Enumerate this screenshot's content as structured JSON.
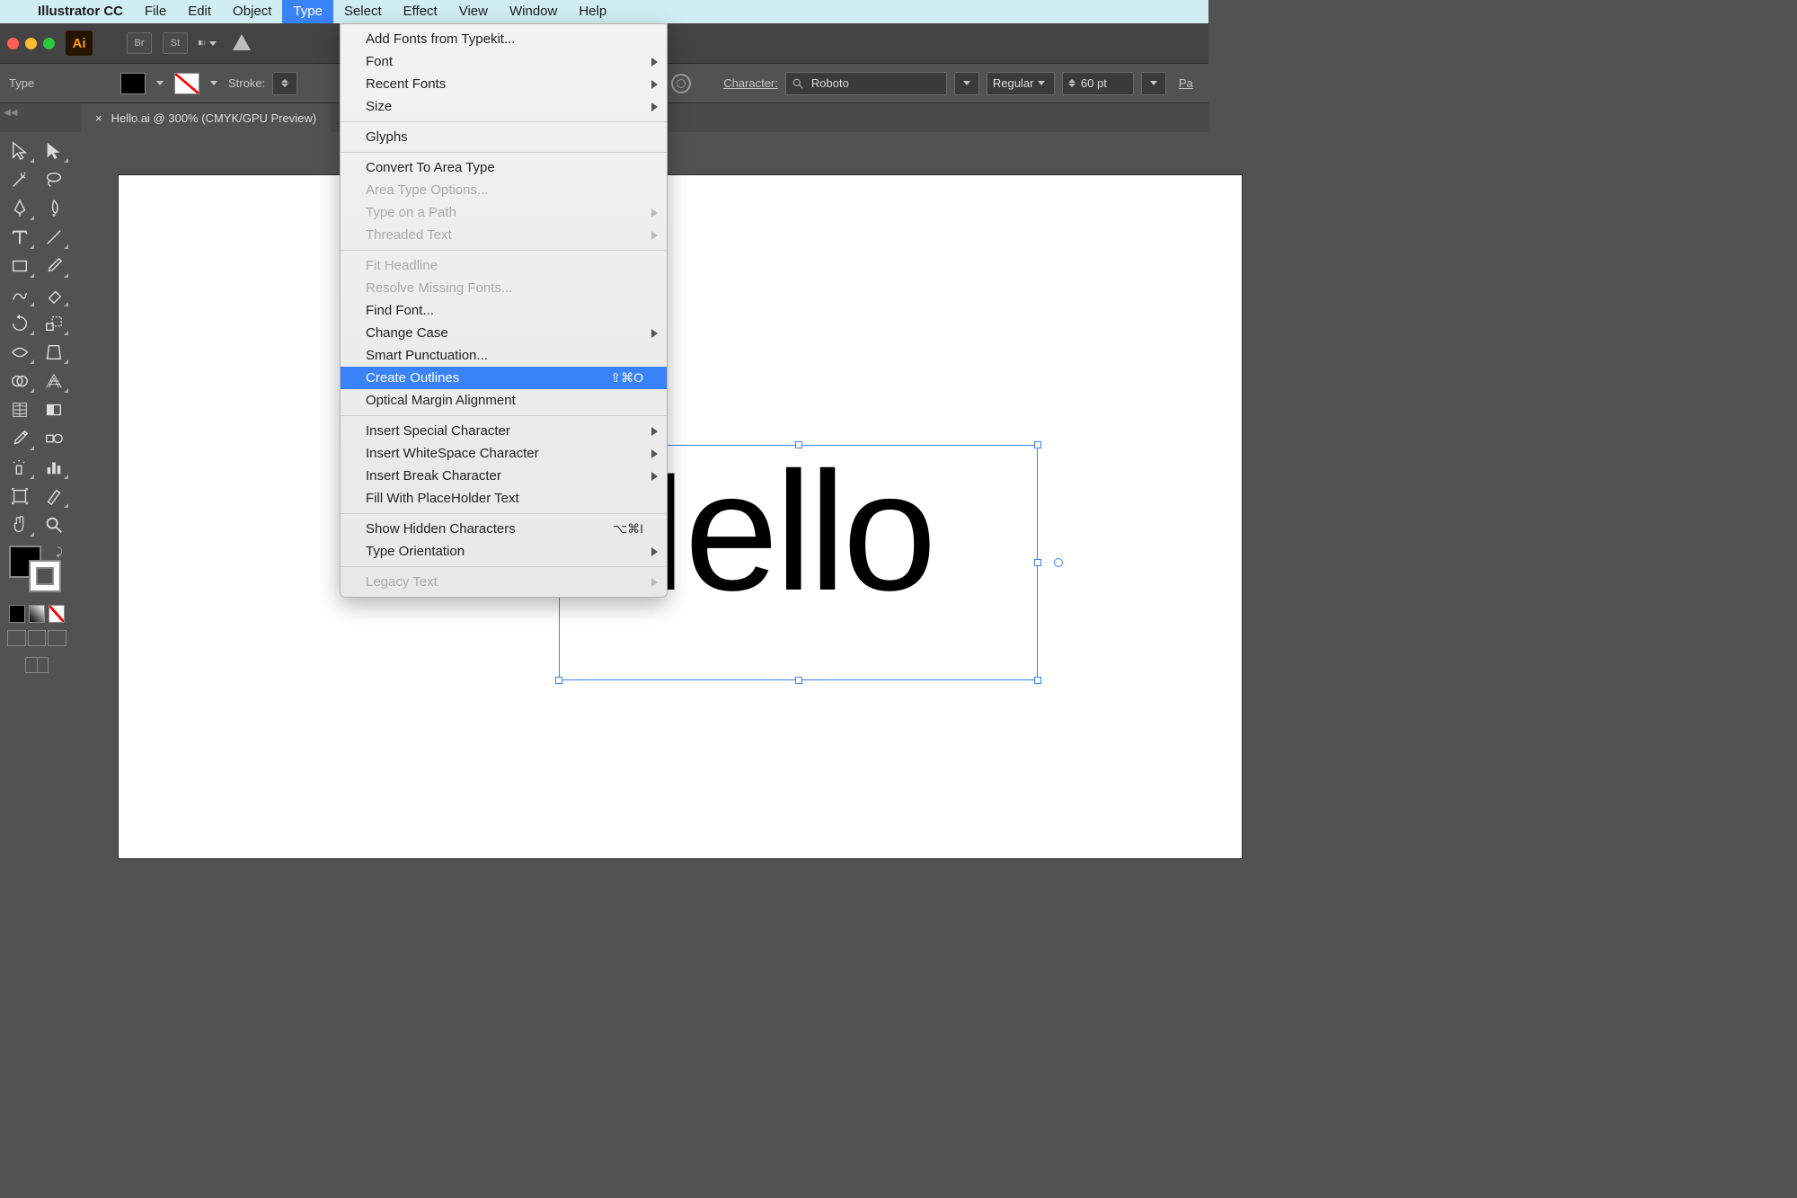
{
  "menubar": {
    "apple": "",
    "app_name": "Illustrator CC",
    "items": [
      "File",
      "Edit",
      "Object",
      "Type",
      "Select",
      "Effect",
      "View",
      "Window",
      "Help"
    ],
    "active_index": 3
  },
  "app_header": {
    "logo": "Ai",
    "br_btn": "Br",
    "st_btn": "St"
  },
  "control_bar": {
    "mode_label": "Type",
    "stroke_label": "Stroke:",
    "character_label": "Character:",
    "font_value": "Roboto",
    "weight_value": "Regular",
    "size_value": "60 pt",
    "paragraph_partial": "Pa"
  },
  "document": {
    "tab_title": "Hello.ai @ 300% (CMYK/GPU Preview)",
    "canvas_text": "Hello"
  },
  "type_menu": {
    "groups": [
      [
        {
          "label": "Add Fonts from Typekit..."
        },
        {
          "label": "Font",
          "sub": true
        },
        {
          "label": "Recent Fonts",
          "sub": true
        },
        {
          "label": "Size",
          "sub": true
        }
      ],
      [
        {
          "label": "Glyphs"
        }
      ],
      [
        {
          "label": "Convert To Area Type"
        },
        {
          "label": "Area Type Options...",
          "disabled": true
        },
        {
          "label": "Type on a Path",
          "sub": true,
          "disabled": true
        },
        {
          "label": "Threaded Text",
          "sub": true,
          "disabled": true
        }
      ],
      [
        {
          "label": "Fit Headline",
          "disabled": true
        },
        {
          "label": "Resolve Missing Fonts...",
          "disabled": true
        },
        {
          "label": "Find Font..."
        },
        {
          "label": "Change Case",
          "sub": true
        },
        {
          "label": "Smart Punctuation..."
        },
        {
          "label": "Create Outlines",
          "shortcut": "⇧⌘O",
          "highlighted": true
        },
        {
          "label": "Optical Margin Alignment"
        }
      ],
      [
        {
          "label": "Insert Special Character",
          "sub": true
        },
        {
          "label": "Insert WhiteSpace Character",
          "sub": true
        },
        {
          "label": "Insert Break Character",
          "sub": true
        },
        {
          "label": "Fill With PlaceHolder Text"
        }
      ],
      [
        {
          "label": "Show Hidden Characters",
          "shortcut": "⌥⌘I"
        },
        {
          "label": "Type Orientation",
          "sub": true
        }
      ],
      [
        {
          "label": "Legacy Text",
          "sub": true,
          "disabled": true
        }
      ]
    ]
  },
  "tools": [
    "selection",
    "direct-selection",
    "magic-wand",
    "lasso",
    "pen",
    "curvature",
    "type",
    "line",
    "rectangle",
    "paintbrush",
    "shaper",
    "eraser",
    "rotate",
    "scale",
    "width",
    "free-transform",
    "shape-builder",
    "perspective-grid",
    "mesh",
    "gradient",
    "eyedropper",
    "blend",
    "symbol-sprayer",
    "column-graph",
    "artboard",
    "slice",
    "hand",
    "zoom"
  ]
}
